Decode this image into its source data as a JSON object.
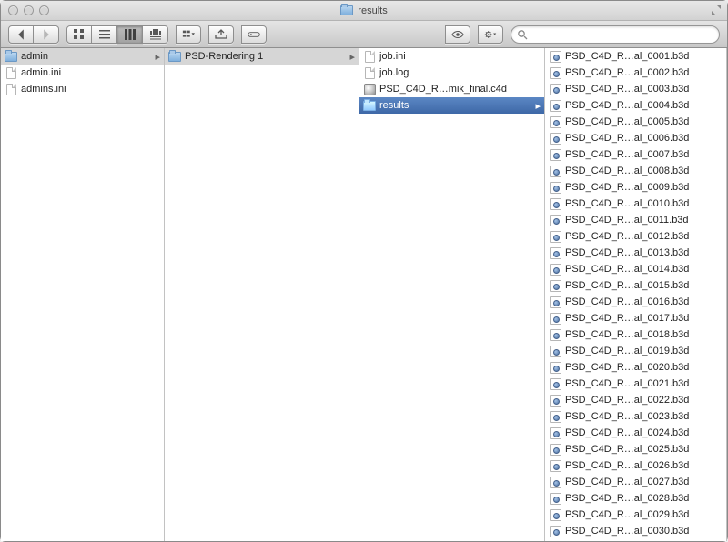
{
  "window": {
    "title": "results"
  },
  "search": {
    "placeholder": ""
  },
  "columns": [
    {
      "items": [
        {
          "name": "admin",
          "type": "folder",
          "nav": true,
          "selected": "dim"
        },
        {
          "name": "admin.ini",
          "type": "doc"
        },
        {
          "name": "admins.ini",
          "type": "doc"
        }
      ]
    },
    {
      "items": [
        {
          "name": "PSD-Rendering 1",
          "type": "folder",
          "nav": true,
          "selected": "dim"
        }
      ]
    },
    {
      "items": [
        {
          "name": "job.ini",
          "type": "doc"
        },
        {
          "name": "job.log",
          "type": "doc"
        },
        {
          "name": "PSD_C4D_R…mik_final.c4d",
          "type": "c4d"
        },
        {
          "name": "results",
          "type": "folder",
          "nav": true,
          "selected": "strong"
        }
      ]
    },
    {
      "items": [
        {
          "name": "PSD_C4D_R…al_0001.b3d",
          "type": "b3d"
        },
        {
          "name": "PSD_C4D_R…al_0002.b3d",
          "type": "b3d"
        },
        {
          "name": "PSD_C4D_R…al_0003.b3d",
          "type": "b3d"
        },
        {
          "name": "PSD_C4D_R…al_0004.b3d",
          "type": "b3d"
        },
        {
          "name": "PSD_C4D_R…al_0005.b3d",
          "type": "b3d"
        },
        {
          "name": "PSD_C4D_R…al_0006.b3d",
          "type": "b3d"
        },
        {
          "name": "PSD_C4D_R…al_0007.b3d",
          "type": "b3d"
        },
        {
          "name": "PSD_C4D_R…al_0008.b3d",
          "type": "b3d"
        },
        {
          "name": "PSD_C4D_R…al_0009.b3d",
          "type": "b3d"
        },
        {
          "name": "PSD_C4D_R…al_0010.b3d",
          "type": "b3d"
        },
        {
          "name": "PSD_C4D_R…al_0011.b3d",
          "type": "b3d"
        },
        {
          "name": "PSD_C4D_R…al_0012.b3d",
          "type": "b3d"
        },
        {
          "name": "PSD_C4D_R…al_0013.b3d",
          "type": "b3d"
        },
        {
          "name": "PSD_C4D_R…al_0014.b3d",
          "type": "b3d"
        },
        {
          "name": "PSD_C4D_R…al_0015.b3d",
          "type": "b3d"
        },
        {
          "name": "PSD_C4D_R…al_0016.b3d",
          "type": "b3d"
        },
        {
          "name": "PSD_C4D_R…al_0017.b3d",
          "type": "b3d"
        },
        {
          "name": "PSD_C4D_R…al_0018.b3d",
          "type": "b3d"
        },
        {
          "name": "PSD_C4D_R…al_0019.b3d",
          "type": "b3d"
        },
        {
          "name": "PSD_C4D_R…al_0020.b3d",
          "type": "b3d"
        },
        {
          "name": "PSD_C4D_R…al_0021.b3d",
          "type": "b3d"
        },
        {
          "name": "PSD_C4D_R…al_0022.b3d",
          "type": "b3d"
        },
        {
          "name": "PSD_C4D_R…al_0023.b3d",
          "type": "b3d"
        },
        {
          "name": "PSD_C4D_R…al_0024.b3d",
          "type": "b3d"
        },
        {
          "name": "PSD_C4D_R…al_0025.b3d",
          "type": "b3d"
        },
        {
          "name": "PSD_C4D_R…al_0026.b3d",
          "type": "b3d"
        },
        {
          "name": "PSD_C4D_R…al_0027.b3d",
          "type": "b3d"
        },
        {
          "name": "PSD_C4D_R…al_0028.b3d",
          "type": "b3d"
        },
        {
          "name": "PSD_C4D_R…al_0029.b3d",
          "type": "b3d"
        },
        {
          "name": "PSD_C4D_R…al_0030.b3d",
          "type": "b3d"
        }
      ]
    }
  ]
}
